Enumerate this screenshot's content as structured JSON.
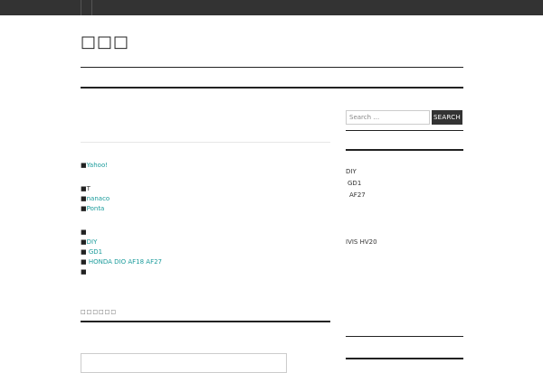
{
  "header": {
    "site_title": "□□□"
  },
  "main": {
    "list_a": [
      {
        "bullet": "■",
        "label": "Yahoo!",
        "is_link": true
      }
    ],
    "list_b": [
      {
        "bullet": "■",
        "label": "T",
        "is_link": false
      },
      {
        "bullet": "■",
        "label": "nanaco",
        "is_link": true
      },
      {
        "bullet": "■",
        "label": "Ponta",
        "is_link": true
      }
    ],
    "list_c": [
      {
        "bullet": "■",
        "label": "",
        "is_link": false
      },
      {
        "bullet": "■",
        "label": "DIY",
        "is_link": true
      },
      {
        "bullet": "■",
        "label": " GD1",
        "is_link": true
      },
      {
        "bullet": "■",
        "label": " HONDA DIO AF18 AF27",
        "is_link": true
      },
      {
        "bullet": "■",
        "label": "",
        "is_link": false
      }
    ],
    "widget_title": "□□□□□□"
  },
  "sidebar": {
    "search": {
      "placeholder": "Search …",
      "button_label": "SEARCH"
    },
    "categories": [
      {
        "label": "DIY"
      },
      {
        "label": "GD1"
      },
      {
        "label": "AF27"
      }
    ],
    "recent": [
      {
        "label": "IVIS HV20"
      }
    ]
  },
  "colors": {
    "topbar": "#333333",
    "link": "#1a9b9b",
    "rule": "#222222",
    "search_button": "#333333"
  }
}
